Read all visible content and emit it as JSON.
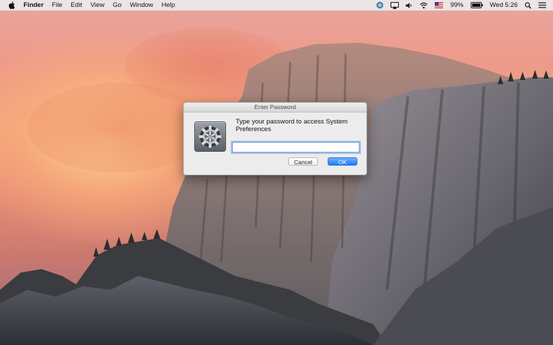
{
  "menubar": {
    "app_name": "Finder",
    "menus": [
      "File",
      "Edit",
      "View",
      "Go",
      "Window",
      "Help"
    ],
    "battery": "99%",
    "clock": "Wed 5:26",
    "status_icons": [
      "vpn-shield-icon",
      "airplay-display-icon",
      "volume-icon",
      "wifi-icon",
      "flag-us-icon",
      "battery-icon",
      "spotlight-search-icon",
      "notification-center-icon"
    ]
  },
  "dialog": {
    "title": "Enter Password",
    "message": "Type your password to access System Preferences",
    "password_value": "",
    "icon": "system-preferences-gear-icon",
    "cancel_label": "Cancel",
    "ok_label": "OK"
  },
  "colors": {
    "ok_button": "#1d7ef5",
    "focus_ring": "#5f96e6"
  }
}
